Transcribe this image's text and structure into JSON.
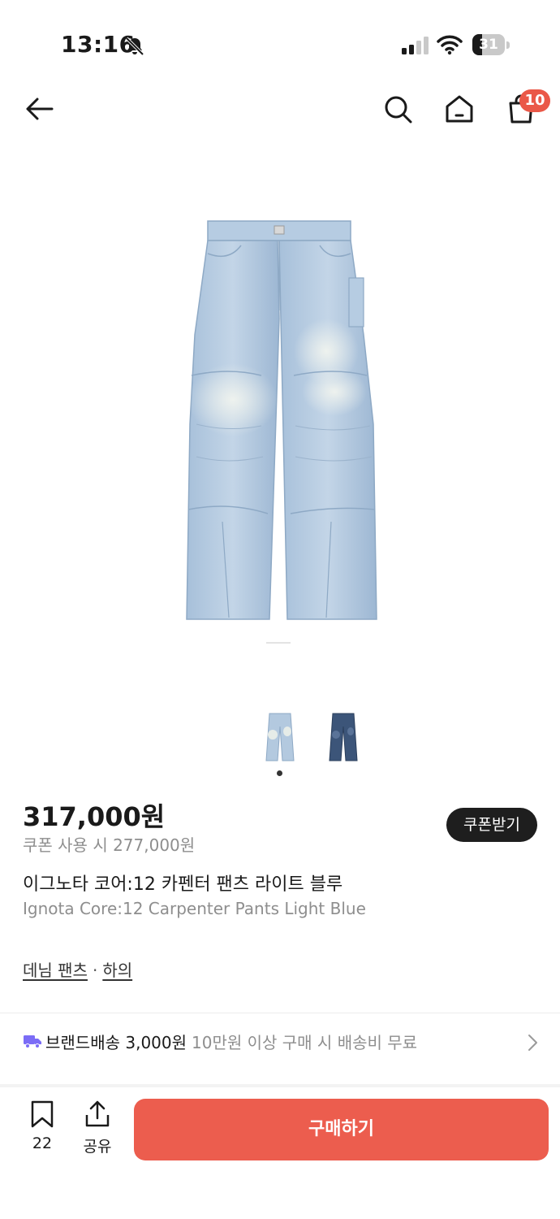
{
  "status_bar": {
    "time": "13:16",
    "battery": 31,
    "bell_icon": "bell-slash-icon",
    "signal_icon": "cellular-signal-icon",
    "wifi_icon": "wifi-icon"
  },
  "nav": {
    "back_icon": "arrow-left-icon",
    "search_icon": "search-icon",
    "home_icon": "home-icon",
    "cart_icon": "shopping-bag-icon",
    "cart_count": "10"
  },
  "gallery": {
    "active_index": 0,
    "thumbnail_count": 2
  },
  "product": {
    "price": "317,000원",
    "coupon_price": "쿠폰 사용 시 277,000원",
    "coupon_button": "쿠폰받기",
    "name_ko": "이그노타 코어:12 카펜터 팬츠 라이트 블루",
    "name_en": "Ignota Core:12 Carpenter Pants Light Blue",
    "categories": [
      "데님 팬츠",
      "하의"
    ],
    "category_separator": "·"
  },
  "shipping": {
    "icon": "truck-icon",
    "label": "브랜드배송 3,000원",
    "note": "10만원 이상 구매 시 배송비 무료"
  },
  "bottom_bar": {
    "bookmark_icon": "bookmark-icon",
    "bookmark_count": "22",
    "share_icon": "share-icon",
    "share_label": "공유",
    "buy_label": "구매하기"
  },
  "colors": {
    "accent": "#ec5d4e",
    "badge": "#ea5848",
    "coupon_button_bg": "#1e1e1e",
    "muted_text": "#8e8e8e",
    "truck": "#7b6cf6",
    "denim_light": "#a9c2dc",
    "denim_dark": "#3c5579"
  }
}
